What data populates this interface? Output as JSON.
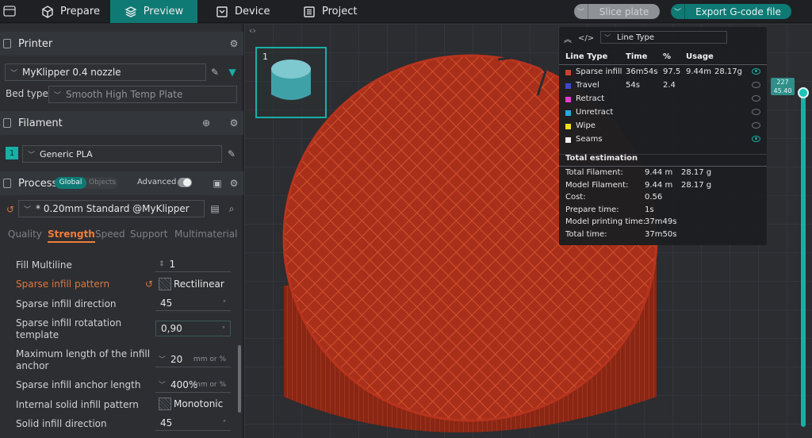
{
  "tabs": [
    {
      "label": "Prepare",
      "icon": "cube-icon"
    },
    {
      "label": "Preview",
      "icon": "layers-icon"
    },
    {
      "label": "Device",
      "icon": "monitor-icon"
    },
    {
      "label": "Project",
      "icon": "list-icon"
    }
  ],
  "actions": {
    "slice": "Slice plate",
    "export": "Export G-code file"
  },
  "printer": {
    "header": "Printer",
    "name": "MyKlipper 0.4 nozzle",
    "bed_label": "Bed type",
    "bed_value": "Smooth High Temp Plate"
  },
  "filament": {
    "header": "Filament",
    "index": "1",
    "name": "Generic PLA"
  },
  "process": {
    "header": "Process",
    "toggle_global": "Global",
    "toggle_objects": "Objects",
    "advanced": "Advanced",
    "preset": "* 0.20mm Standard @MyKlipper"
  },
  "subtabs": [
    "Quality",
    "Strength",
    "Speed",
    "Support",
    "Multimaterial"
  ],
  "settings": {
    "fill_multiline": {
      "label": "Fill Multiline",
      "value": "1"
    },
    "sparse_pattern": {
      "label": "Sparse infill pattern",
      "value": "Rectilinear"
    },
    "sparse_direction": {
      "label": "Sparse infill direction",
      "value": "45"
    },
    "rotation_template": {
      "label1": "Sparse infill rotatation",
      "label2": "template",
      "value": "0,90"
    },
    "anchor_max": {
      "label1": "Maximum length of the infill",
      "label2": "anchor",
      "value": "20",
      "unit": "mm or %"
    },
    "anchor_len": {
      "label": "Sparse infill anchor length",
      "value": "400%",
      "unit": "mm or %"
    },
    "internal_pattern": {
      "label": "Internal solid infill pattern",
      "value": "Monotonic"
    },
    "solid_direction": {
      "label": "Solid infill direction",
      "value": "45"
    }
  },
  "plate": {
    "number": "1"
  },
  "legend": {
    "selector": "Line Type",
    "columns": [
      "Line Type",
      "Time",
      "%",
      "Usage"
    ],
    "rows": [
      {
        "name": "Sparse infill",
        "color": "#c8442c",
        "time": "36m54s",
        "pct": "97.5",
        "len": "9.44m",
        "weight": "28.17g",
        "visible": true
      },
      {
        "name": "Travel",
        "color": "#3a4cc4",
        "time": "54s",
        "pct": "2.4",
        "len": "",
        "weight": "",
        "visible": false
      },
      {
        "name": "Retract",
        "color": "#e040c8",
        "time": "",
        "pct": "",
        "len": "",
        "weight": "",
        "visible": false
      },
      {
        "name": "Unretract",
        "color": "#2aa8e0",
        "time": "",
        "pct": "",
        "len": "",
        "weight": "",
        "visible": false
      },
      {
        "name": "Wipe",
        "color": "#f0e020",
        "time": "",
        "pct": "",
        "len": "",
        "weight": "",
        "visible": false
      },
      {
        "name": "Seams",
        "color": "#f0f0f0",
        "time": "",
        "pct": "",
        "len": "",
        "weight": "",
        "visible": true
      }
    ],
    "total_header": "Total estimation",
    "totals": [
      {
        "label": "Total Filament:",
        "v1": "9.44 m",
        "v2": "28.17 g"
      },
      {
        "label": "Model Filament:",
        "v1": "9.44 m",
        "v2": "28.17 g"
      },
      {
        "label": "Cost:",
        "v1": "0.56",
        "v2": ""
      },
      {
        "label": "Prepare time:",
        "v1": "1s",
        "v2": ""
      },
      {
        "label": "Model printing time:",
        "v1": "37m49s",
        "v2": ""
      },
      {
        "label": "Total time:",
        "v1": "37m50s",
        "v2": ""
      }
    ]
  },
  "layer_slider": {
    "top": "227",
    "height": "45.40"
  },
  "colors": {
    "accent": "#0f7a74",
    "changed": "#e0763c",
    "infill": "#b8341e"
  }
}
